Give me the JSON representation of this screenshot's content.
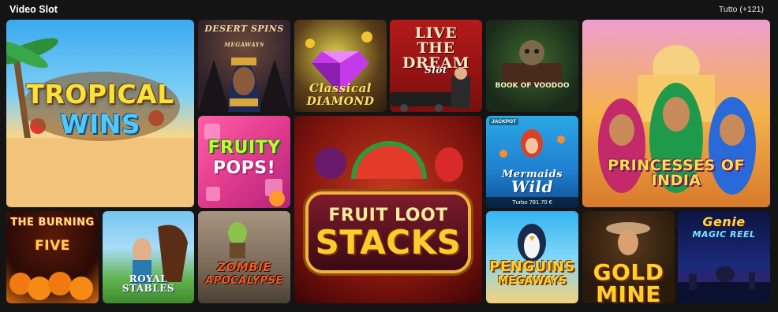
{
  "header": {
    "title": "Video Slot",
    "see_all": "Tutto (+121)"
  },
  "games": [
    {
      "id": "tropical",
      "title": "TROPICAL",
      "subtitle": "WINS"
    },
    {
      "id": "desert",
      "title": "DESERT SPINS",
      "subtitle": "MEGAWAYS"
    },
    {
      "id": "diamond",
      "title": "Classical",
      "subtitle": "DIAMOND"
    },
    {
      "id": "dream",
      "title": "LIVE THE DREAM",
      "subtitle": "Slot"
    },
    {
      "id": "voodoo",
      "title": "BOOK OF VOODOO"
    },
    {
      "id": "india",
      "title": "PRINCESSES OF INDIA"
    },
    {
      "id": "fruity",
      "title": "FRUITY",
      "subtitle": "POPS!"
    },
    {
      "id": "fruitloot",
      "title": "FRUIT LOOT",
      "subtitle": "STACKS"
    },
    {
      "id": "mermaids",
      "title": "Mermaids",
      "subtitle": "Wild",
      "badge": "JACKPOT",
      "jackpot": "Turbo 781.70 €"
    },
    {
      "id": "burning",
      "title": "THE BURNING",
      "subtitle": "FIVE"
    },
    {
      "id": "royal",
      "title": "ROYAL STABLES"
    },
    {
      "id": "zombie",
      "title": "ZOMBIE",
      "subtitle": "APOCALYPSE"
    },
    {
      "id": "penguins",
      "title": "PENGUINS",
      "subtitle": "MEGAWAYS"
    },
    {
      "id": "goldmine",
      "title": "GOLD MINE"
    },
    {
      "id": "genie",
      "title": "Genie",
      "subtitle": "MAGIC REEL"
    }
  ]
}
